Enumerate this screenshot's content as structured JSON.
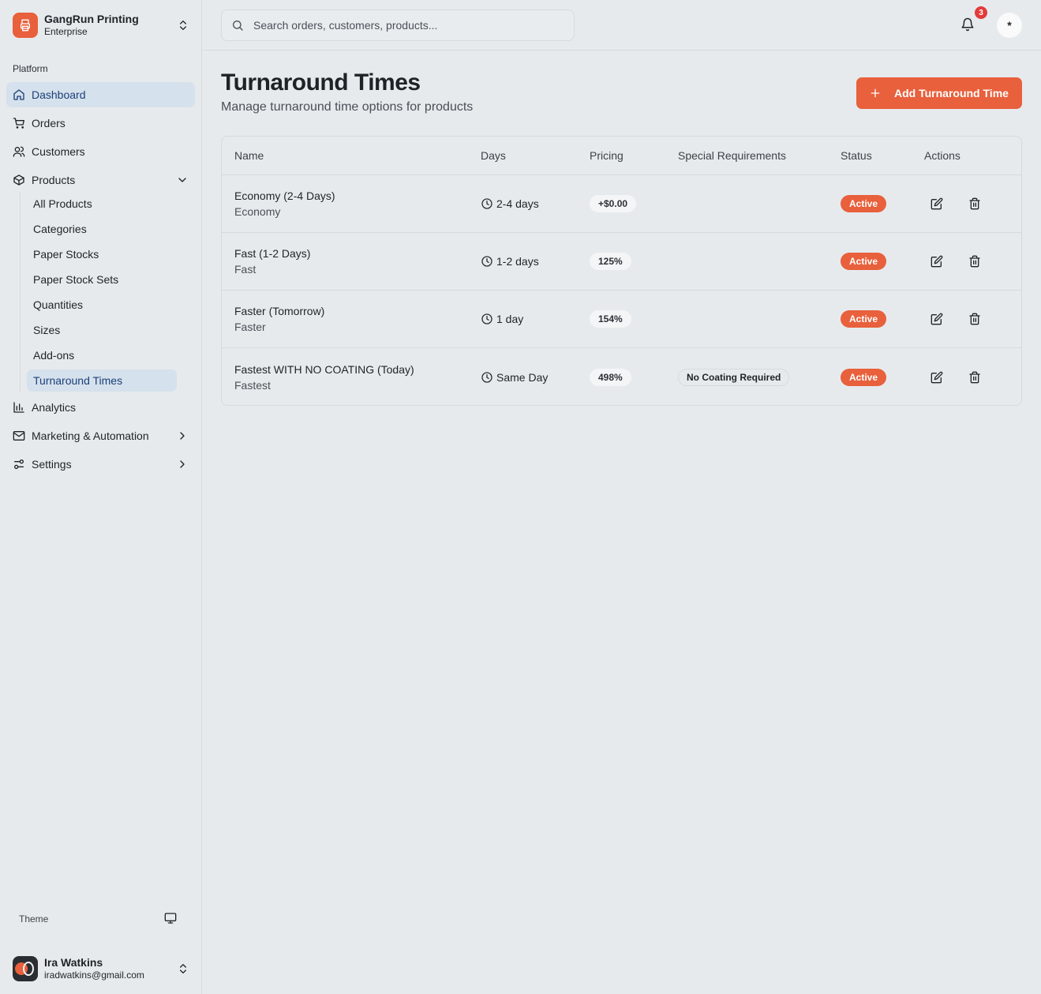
{
  "brand": {
    "name": "GangRun Printing",
    "plan": "Enterprise"
  },
  "sidebar": {
    "section_label": "Platform",
    "items": [
      {
        "label": "Dashboard",
        "icon": "home-icon",
        "active": true
      },
      {
        "label": "Orders",
        "icon": "cart-icon"
      },
      {
        "label": "Customers",
        "icon": "users-icon"
      },
      {
        "label": "Products",
        "icon": "box-icon",
        "expanded": true
      },
      {
        "label": "Analytics",
        "icon": "bar-chart-icon"
      },
      {
        "label": "Marketing & Automation",
        "icon": "mail-icon"
      },
      {
        "label": "Settings",
        "icon": "sliders-icon"
      }
    ],
    "product_subitems": [
      {
        "label": "All Products"
      },
      {
        "label": "Categories"
      },
      {
        "label": "Paper Stocks"
      },
      {
        "label": "Paper Stock Sets"
      },
      {
        "label": "Quantities"
      },
      {
        "label": "Sizes"
      },
      {
        "label": "Add-ons"
      },
      {
        "label": "Turnaround Times",
        "active": true
      }
    ],
    "theme_label": "Theme",
    "user": {
      "name": "Ira Watkins",
      "email": "iradwatkins@gmail.com"
    }
  },
  "topbar": {
    "search_placeholder": "Search orders, customers, products...",
    "notification_count": "3",
    "profile_initial": "*"
  },
  "main": {
    "title": "Turnaround Times",
    "subtitle": "Manage turnaround time options for products",
    "add_button_label": "Add Turnaround Time"
  },
  "table": {
    "headers": {
      "name": "Name",
      "days": "Days",
      "pricing": "Pricing",
      "special": "Special Requirements",
      "status": "Status",
      "actions": "Actions"
    },
    "rows": [
      {
        "name": "Economy (2-4 Days)",
        "short": "Economy",
        "days": "2-4 days",
        "pricing": "+$0.00",
        "special": "",
        "status": "Active"
      },
      {
        "name": "Fast (1-2 Days)",
        "short": "Fast",
        "days": "1-2 days",
        "pricing": "125%",
        "special": "",
        "status": "Active"
      },
      {
        "name": "Faster (Tomorrow)",
        "short": "Faster",
        "days": "1 day",
        "pricing": "154%",
        "special": "",
        "status": "Active"
      },
      {
        "name": "Fastest WITH NO COATING (Today)",
        "short": "Fastest",
        "days": "Same Day",
        "pricing": "498%",
        "special": "No Coating Required",
        "status": "Active"
      }
    ]
  },
  "colors": {
    "accent": "#e8603c",
    "active_nav_bg": "#d5e1ec",
    "active_nav_text": "#1c3f7a",
    "badge_red": "#e23b3b",
    "background": "#e7eaed"
  }
}
